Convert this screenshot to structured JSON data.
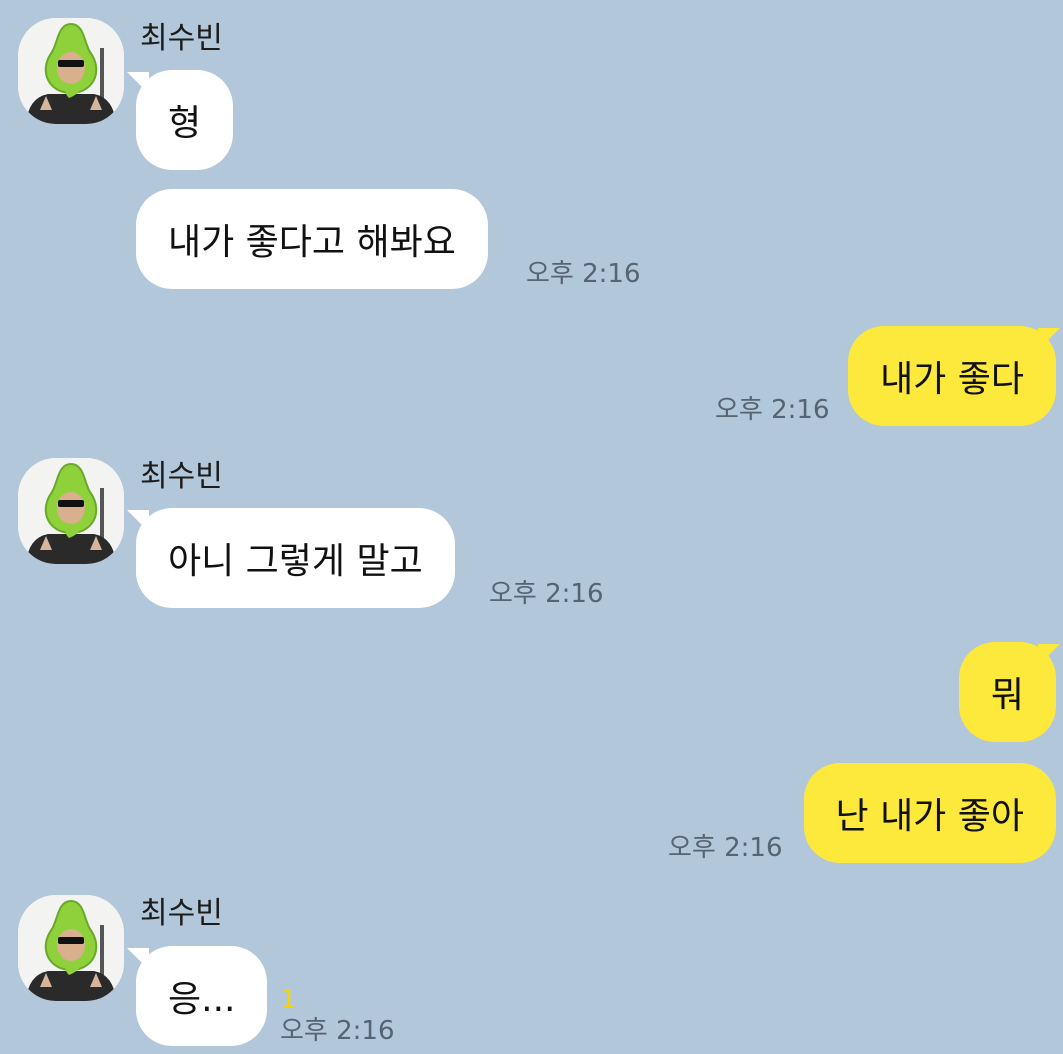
{
  "chat": {
    "sender": "최수빈",
    "avatar_icon": "profile-photo-avocado-hat",
    "colors": {
      "background": "#b2c7da",
      "incoming_bubble": "#ffffff",
      "outgoing_bubble": "#fde93c",
      "timestamp": "#556372",
      "unread_badge": "#f5d400"
    },
    "messages": [
      {
        "from": "incoming",
        "text": "형"
      },
      {
        "from": "incoming",
        "text": "내가 좋다고 해봐요",
        "time": "오후 2:16"
      },
      {
        "from": "outgoing",
        "text": "내가 좋다",
        "time": "오후 2:16"
      },
      {
        "from": "incoming",
        "text": "아니 그렇게 말고",
        "time": "오후 2:16"
      },
      {
        "from": "outgoing",
        "text": "뭐"
      },
      {
        "from": "outgoing",
        "text": "난 내가 좋아",
        "time": "오후 2:16"
      },
      {
        "from": "incoming",
        "text": "응...",
        "time": "오후 2:16",
        "unread": "1"
      }
    ]
  }
}
